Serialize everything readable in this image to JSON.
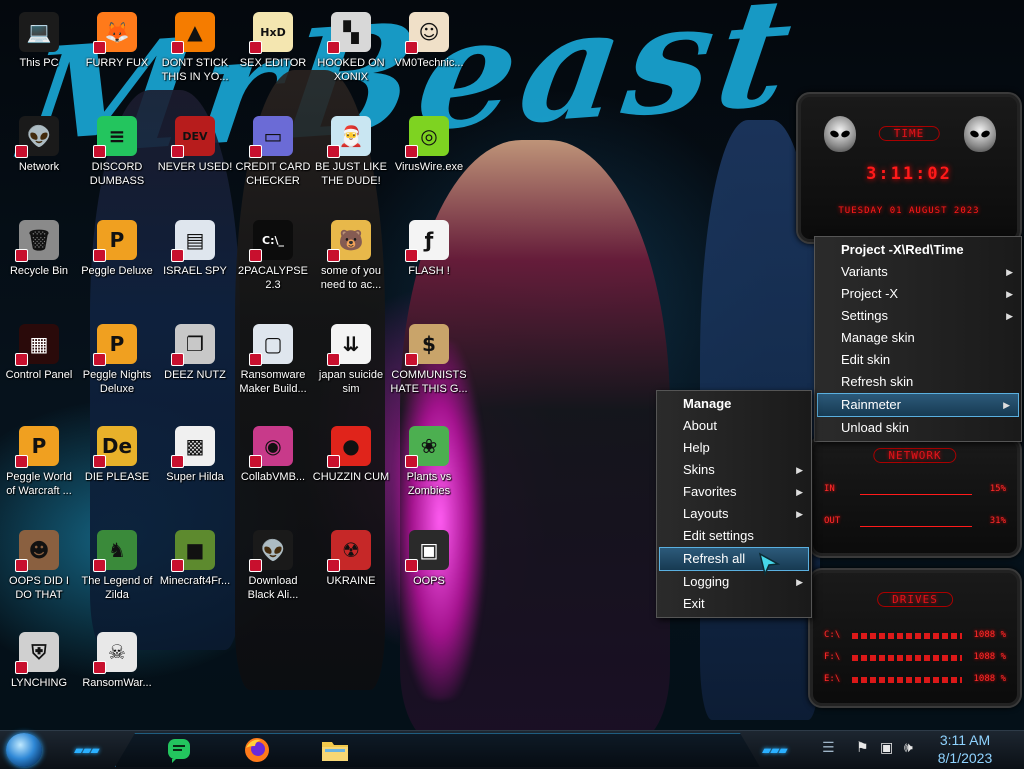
{
  "wallpaper": {
    "title": "MrBeast"
  },
  "desktop_icons": [
    {
      "label": "This PC",
      "icon": "computer-icon"
    },
    {
      "label": "FURRY FUX",
      "icon": "firefox-icon"
    },
    {
      "label": "DONT STICK THIS IN YO...",
      "icon": "vlc-cone-icon"
    },
    {
      "label": "SEX EDITOR",
      "icon": "hxd-editor-icon"
    },
    {
      "label": "HOOKED ON XONIX",
      "icon": "xonix-game-icon"
    },
    {
      "label": "VM0Technic...",
      "icon": "doctor-icon"
    },
    {
      "label": "Network",
      "icon": "alien-network-icon"
    },
    {
      "label": "DISCORD DUMBASS",
      "icon": "chat-icon"
    },
    {
      "label": "NEVER USED!",
      "icon": "dev-cpp-icon"
    },
    {
      "label": "CREDIT CARD CHECKER",
      "icon": "credit-card-icon"
    },
    {
      "label": "BE JUST LIKE THE DUDE!",
      "icon": "santa-icon"
    },
    {
      "label": "VirusWire.exe",
      "icon": "lime-icon"
    },
    {
      "label": "Recycle Bin",
      "icon": "recycle-bin-icon"
    },
    {
      "label": "Peggle Deluxe",
      "icon": "peggle-icon"
    },
    {
      "label": "ISRAEL SPY",
      "icon": "network-card-icon"
    },
    {
      "label": "2PACALYPSE 2.3",
      "icon": "terminal-icon"
    },
    {
      "label": "some of you need to ac...",
      "icon": "bear-icon"
    },
    {
      "label": "FLASH !",
      "icon": "flash-document-icon"
    },
    {
      "label": "Control Panel",
      "icon": "control-panel-icon"
    },
    {
      "label": "Peggle Nights Deluxe",
      "icon": "peggle-icon"
    },
    {
      "label": "DEEZ NUTZ",
      "icon": "windows-stack-icon"
    },
    {
      "label": "Ransomware Maker Build...",
      "icon": "app-window-icon"
    },
    {
      "label": "japan suicide sim",
      "icon": "document-icon"
    },
    {
      "label": "COMMUNISTS HATE THIS G...",
      "icon": "money-bag-icon"
    },
    {
      "label": "Peggle World of Warcraft ...",
      "icon": "peggle-icon"
    },
    {
      "label": "DIE PLEASE",
      "icon": "dreamweaver-icon"
    },
    {
      "label": "Super Hilda",
      "icon": "pixel-character-icon"
    },
    {
      "label": "CollabVMB...",
      "icon": "disc-icon"
    },
    {
      "label": "CHUZZIN CUM",
      "icon": "chuzzle-icon"
    },
    {
      "label": "Plants vs Zombies",
      "icon": "plant-icon"
    },
    {
      "label": "OOPS DID I DO THAT",
      "icon": "portrait-icon"
    },
    {
      "label": "The Legend of Zilda",
      "icon": "pixel-hero-icon"
    },
    {
      "label": "Minecraft4Fr...",
      "icon": "grass-block-icon"
    },
    {
      "label": "Download Black Ali...",
      "icon": "alien-network-icon"
    },
    {
      "label": "UKRAINE",
      "icon": "radiation-icon"
    },
    {
      "label": "OOPS",
      "icon": "monitor-icon"
    },
    {
      "label": "LYNCHING",
      "icon": "shield-flag-icon"
    },
    {
      "label": "RansomWar...",
      "icon": "skull-icon"
    }
  ],
  "skins": {
    "time": {
      "title": "TIME",
      "time": "3:11:02",
      "date": "TUESDAY 01 AUGUST 2023"
    },
    "network": {
      "title": "NETWORK",
      "in_label": "IN",
      "in_value": "15%",
      "out_label": "OUT",
      "out_value": "31%"
    },
    "drives": {
      "title": "DRIVES",
      "rows": [
        {
          "label": "C:\\",
          "value": "1088 %"
        },
        {
          "label": "F:\\",
          "value": "1088 %"
        },
        {
          "label": "E:\\",
          "value": "1088 %"
        }
      ]
    }
  },
  "skin_menu": {
    "items": [
      {
        "label": "Project -X\\Red\\Time",
        "bold": true,
        "arrow": false
      },
      {
        "label": "Variants",
        "arrow": true
      },
      {
        "label": "Project -X",
        "arrow": true
      },
      {
        "label": "Settings",
        "arrow": true
      },
      {
        "label": "Manage skin",
        "arrow": false
      },
      {
        "label": "Edit skin",
        "arrow": false
      },
      {
        "label": "Refresh skin",
        "arrow": false
      },
      {
        "label": "Rainmeter",
        "arrow": true,
        "highlighted": true
      },
      {
        "label": "Unload skin",
        "arrow": false
      }
    ]
  },
  "rainmeter_menu": {
    "items": [
      {
        "label": "Manage",
        "bold": true,
        "arrow": false
      },
      {
        "label": "About",
        "arrow": false
      },
      {
        "label": "Help",
        "arrow": false
      },
      {
        "label": "Skins",
        "arrow": true
      },
      {
        "label": "Favorites",
        "arrow": true
      },
      {
        "label": "Layouts",
        "arrow": true
      },
      {
        "label": "Edit settings",
        "arrow": false
      },
      {
        "label": "Refresh all",
        "arrow": false,
        "highlighted": true
      },
      {
        "label": "Logging",
        "arrow": true
      },
      {
        "label": "Exit",
        "arrow": false
      }
    ]
  },
  "taskbar": {
    "pinned": [
      {
        "name": "chat-app",
        "icon": "chat-bubble-icon"
      },
      {
        "name": "firefox",
        "icon": "firefox-icon"
      },
      {
        "name": "file-explorer",
        "icon": "folder-icon"
      }
    ],
    "tray_icons": [
      "flag-icon",
      "network-icon",
      "volume-icon"
    ],
    "clock": {
      "time": "3:11 AM",
      "date": "8/1/2023"
    }
  },
  "colors": {
    "accent_red": "#ff1a1a",
    "accent_blue": "#2ab0ff",
    "menu_highlight": "#2c5a7a"
  }
}
